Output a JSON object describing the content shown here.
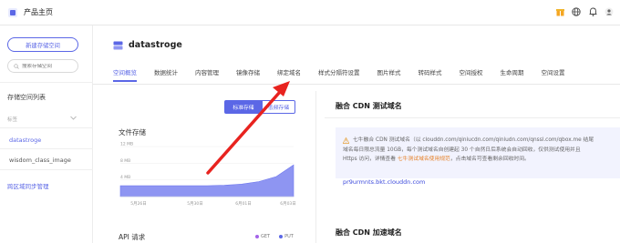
{
  "header": {
    "product_home": "产品主页"
  },
  "sidebar": {
    "new_bucket": "新建存储空间",
    "search_placeholder": "搜索存储空间",
    "list_title": "存储空间列表",
    "tag_filter": "标签",
    "buckets": [
      "datastroge",
      "wisdom_class_image"
    ],
    "sync_link": "跨区域同步管理"
  },
  "bucket": {
    "name": "datastroge"
  },
  "tabs": [
    "空间概览",
    "数据统计",
    "内容管理",
    "镜像存储",
    "绑定域名",
    "样式分隔符设置",
    "图片样式",
    "转码样式",
    "空间授权",
    "生命周期",
    "空间设置"
  ],
  "storage_toggle": {
    "standard": "标准存储",
    "low_freq": "低频存储"
  },
  "file_storage": {
    "title": "文件存储"
  },
  "chart_data": {
    "type": "area",
    "x": [
      "5月26日",
      "5月30日",
      "6月01日",
      "6月03日"
    ],
    "y_ticks": [
      "12 MB",
      "8 MB",
      "4 MB"
    ],
    "ylim": [
      0,
      12
    ],
    "values": [
      2.6,
      2.6,
      2.6,
      2.6,
      2.6,
      2.6,
      2.7,
      3.0,
      3.6,
      4.8,
      7.6
    ],
    "color": "#8e95f2"
  },
  "api": {
    "title": "API 请求",
    "legend": [
      "GET",
      "PUT"
    ]
  },
  "cdn": {
    "title": "融合 CDN 测试域名",
    "notice_lines": [
      "七牛融合 CDN 测试域名（以 clouddn.com/qiniucdn.com/qiniudn.com/qnssl.com/qbox.me 结尾",
      "域名每日限总流量 10GB，每个测试域名自创建起 30 个自然日后系统会自动回收，仅供测试使用并且",
      "Https 访问，详情查看 "
    ],
    "notice_link": "七牛测试域名使用规范",
    "notice_tail": "，点击域名可查看剩余回收时间。",
    "domain": "pr9urmnts.bkt.clouddn.com",
    "accel_title": "融合 CDN 加速域名"
  },
  "colors": {
    "accent": "#5b67e6",
    "arrow": "#e8231f"
  }
}
